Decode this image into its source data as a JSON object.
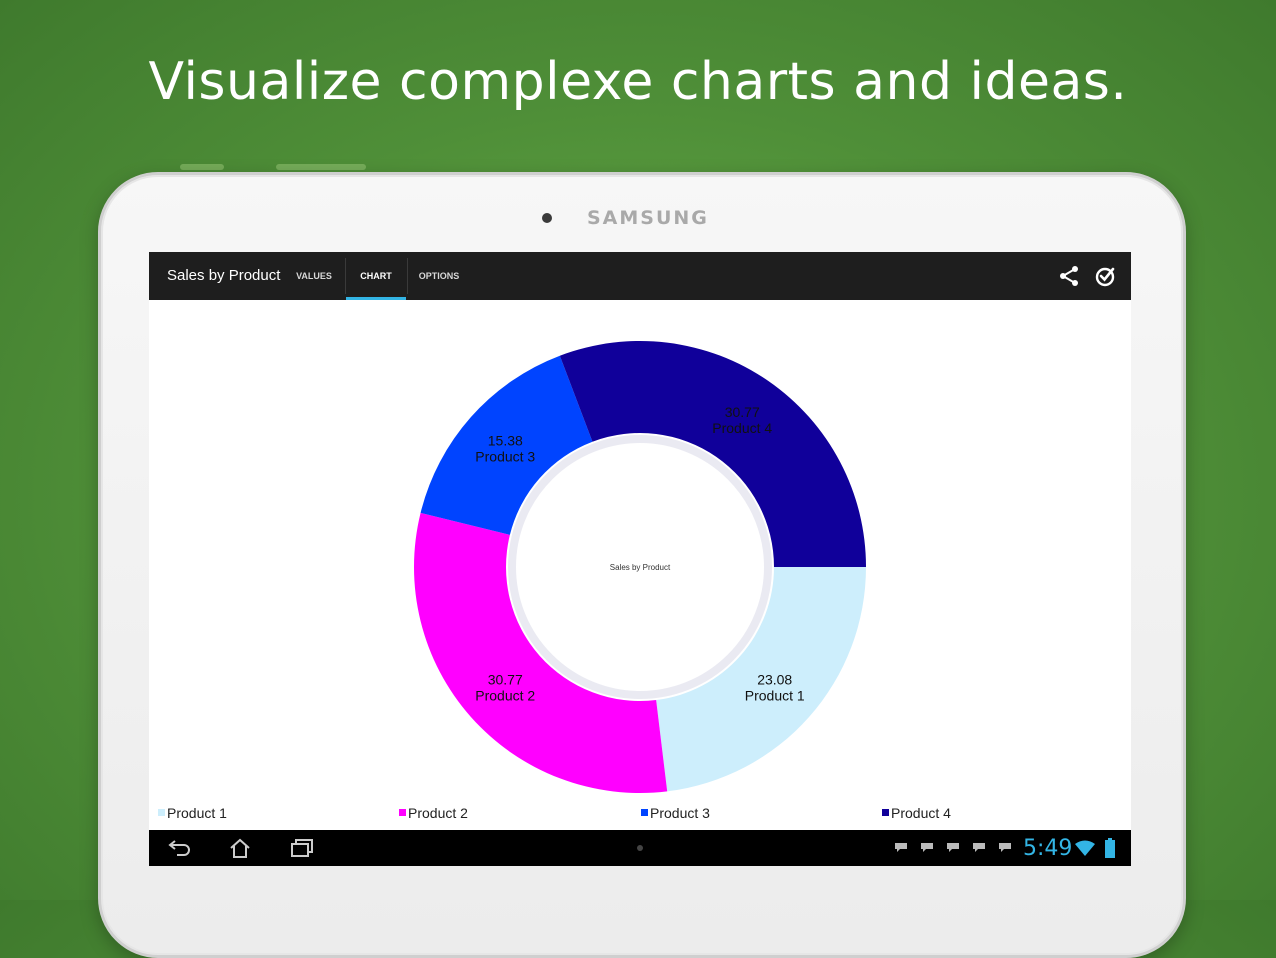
{
  "headline": "Visualize complexe charts and ideas.",
  "device": {
    "brand": "SAMSUNG"
  },
  "app": {
    "title": "Sales by Product",
    "tabs": [
      {
        "label": "VALUES",
        "active": false
      },
      {
        "label": "CHART",
        "active": true
      },
      {
        "label": "OPTIONS",
        "active": false
      }
    ],
    "actions": [
      "share-icon",
      "check-circle-icon"
    ],
    "accent_color": "#33b5e5"
  },
  "chart_data": {
    "type": "pie",
    "variant": "donut",
    "center_label": "Sales by Product",
    "slices": [
      {
        "name": "Product 1",
        "value": 23.08,
        "color": "#cdeefc"
      },
      {
        "name": "Product 2",
        "value": 30.77,
        "color": "#ff00ff"
      },
      {
        "name": "Product 3",
        "value": 15.38,
        "color": "#0044ff"
      },
      {
        "name": "Product 4",
        "value": 30.77,
        "color": "#10009a"
      }
    ],
    "legend": [
      "Product 1",
      "Product 2",
      "Product 3",
      "Product 4"
    ],
    "legend_position": "bottom"
  },
  "system": {
    "time": "5:49",
    "nav_buttons": [
      "back-icon",
      "home-icon",
      "recent-apps-icon"
    ],
    "status_icons": [
      "notification-icon",
      "notification-icon",
      "notification-icon",
      "notification-icon",
      "notification-icon",
      "wifi-icon",
      "battery-icon"
    ]
  }
}
